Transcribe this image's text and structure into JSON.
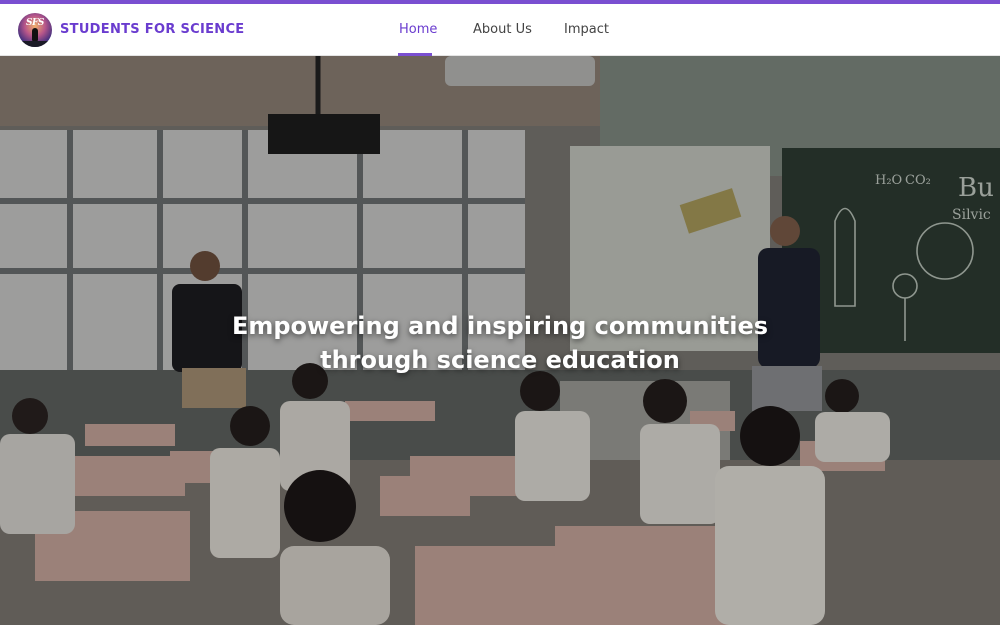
{
  "brand": {
    "logo_text": "SFS",
    "name": "STUDENTS FOR SCIENCE"
  },
  "nav": {
    "items": [
      {
        "label": "Home",
        "active": true
      },
      {
        "label": "About Us",
        "active": false
      },
      {
        "label": "Impact",
        "active": false
      }
    ]
  },
  "hero": {
    "title_line1": "Empowering and inspiring communities",
    "title_line2": "through science education",
    "chalkboard_text": {
      "chem1": "H₂O",
      "chem2": "CO₂",
      "right1": "Bu",
      "right2": "Silvic"
    }
  },
  "colors": {
    "accent": "#7a4fd1",
    "brand_text": "#6a3ccf",
    "nav_text": "#444444"
  }
}
